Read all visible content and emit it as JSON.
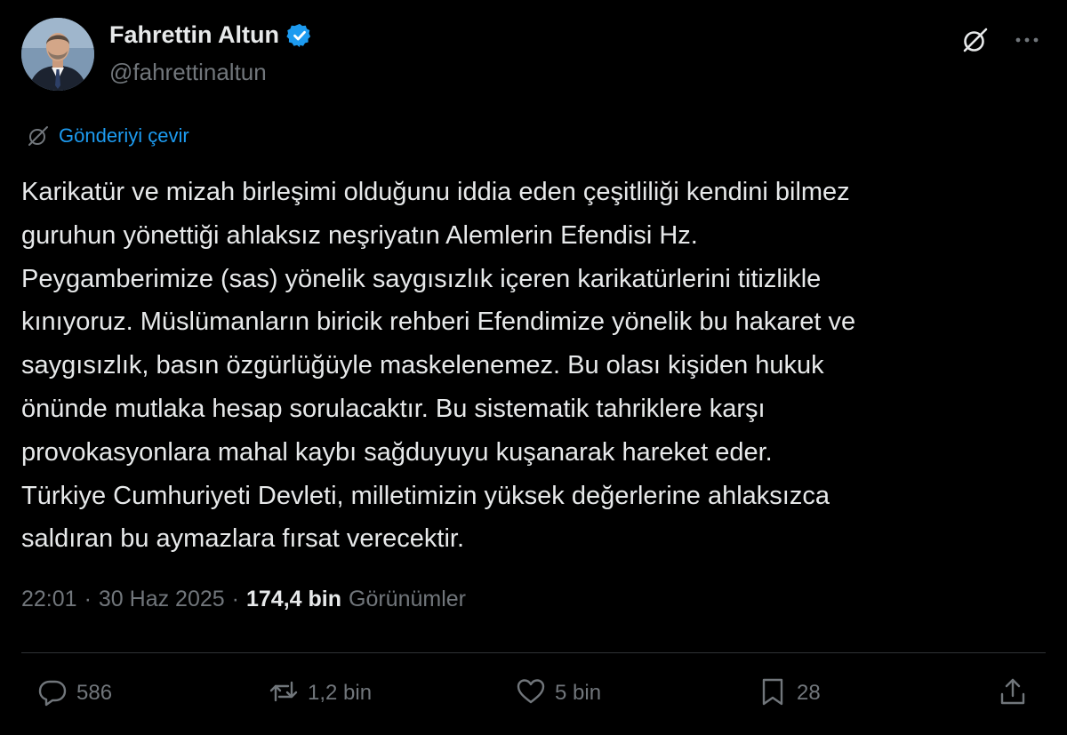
{
  "author": {
    "display_name": "Fahrettin Altun",
    "handle": "@fahrettinaltun",
    "verified": true
  },
  "header_icons": {
    "grok": "grok-icon",
    "more": "more-icon"
  },
  "translate": {
    "label": "Gönderiyi çevir",
    "icon": "translate-icon"
  },
  "tweet": {
    "lines": [
      "Karikatür ve mizah birleşimi olduğunu iddia eden çeşitliliği kendini bilmez",
      "guruhun yönettiği ahlaksız neşriyatın Alemlerin Efendisi Hz.",
      "Peygamberimize (sas) yönelik saygısızlık içeren karikatürlerini titizlikle",
      "kınıyoruz. Müslümanların biricik rehberi Efendimize yönelik bu hakaret ve",
      "saygısızlık, basın özgürlüğüyle maskelenemez. Bu olası kişiden hukuk",
      "önünde mutlaka hesap sorulacaktır. Bu sistematik tahriklere karşı",
      "provokasyonlara mahal kaybı sağduyuyu kuşanarak hareket eder.",
      "Türkiye Cumhuriyeti Devleti, milletimizin yüksek değerlerine ahlaksızca",
      "saldıran bu aymazlara fırsat verecektir."
    ]
  },
  "meta": {
    "time": "22:01",
    "separator": "·",
    "date": "30 Haz 2025",
    "views_count": "174,4 bin",
    "views_label": "Görünümler"
  },
  "actions": {
    "replies": "586",
    "reposts": "1,2 bin",
    "likes": "5 bin",
    "bookmarks": "28"
  },
  "colors": {
    "background": "#000000",
    "text": "#e7e9ea",
    "muted": "#71767b",
    "accent": "#1d9bf0",
    "divider": "#2f3336"
  }
}
